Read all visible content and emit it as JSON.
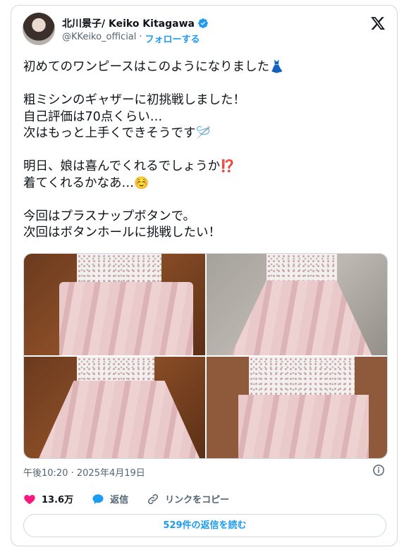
{
  "author": {
    "name": "北川景子/ Keiko Kitagawa",
    "handle": "@KKeiko_official",
    "separator": "·",
    "follow_label": "フォローする",
    "verified": true
  },
  "tweet": {
    "lines": [
      "初めてのワンピースはこのようになりました",
      "",
      "粗ミシンのギャザーに初挑戦しました！",
      "自己評価は70点くらい…",
      "次はもっと上手くできそうです",
      "",
      "明日、娘は喜んでくれるでしょうか",
      "着てくれるかなあ…",
      "",
      "今回はプラスナップボタンで。",
      "次回はボタンホールに挑戦したい！"
    ],
    "emojis": {
      "dress": "👗",
      "needle": "🪡",
      "exclaim": "⁉️",
      "smile": "☺️"
    }
  },
  "photos": [
    {
      "alt": "dress-photo-1"
    },
    {
      "alt": "dress-photo-2"
    },
    {
      "alt": "dress-photo-3"
    },
    {
      "alt": "dress-photo-4"
    }
  ],
  "meta": {
    "time": "午後10:20",
    "separator": "·",
    "date": "2025年4月19日"
  },
  "actions": {
    "likes_count": "13.6万",
    "reply_label": "返信",
    "copy_link_label": "リンクをコピー"
  },
  "read_replies_label": "529件の返信を読む",
  "colors": {
    "accent": "#1d9bf0",
    "like": "#f91880",
    "muted": "#536471",
    "border": "#cfd9de"
  },
  "icons": [
    "verified-badge-icon",
    "x-logo-icon",
    "info-icon",
    "heart-icon",
    "reply-bubble-icon",
    "link-icon"
  ]
}
